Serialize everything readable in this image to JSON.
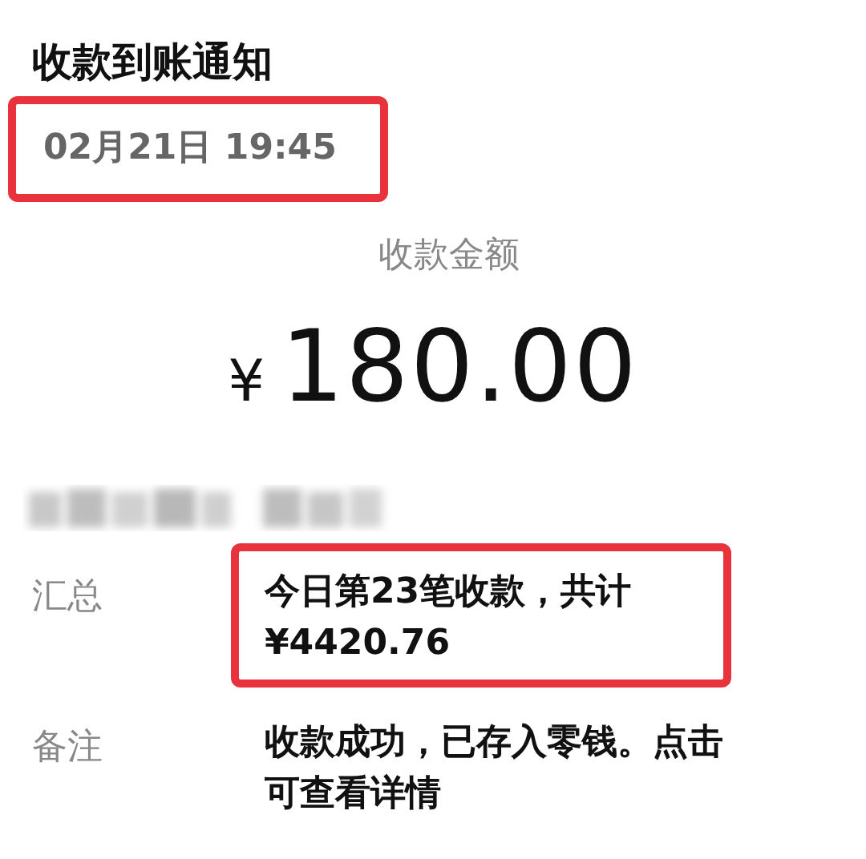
{
  "title": "收款到账通知",
  "time": {
    "text": "02月21日 19:45",
    "highlighted": true
  },
  "amount": {
    "label": "收款金额",
    "currency": "¥",
    "value": "180.00"
  },
  "details": [
    {
      "label": "汇总",
      "lines": [
        "今日第23笔收款，共计",
        "¥4420.76"
      ],
      "highlighted": true
    },
    {
      "label": "备注",
      "lines": [
        "收款成功，已存入零钱。点击可查看详情"
      ],
      "highlighted": false
    }
  ]
}
